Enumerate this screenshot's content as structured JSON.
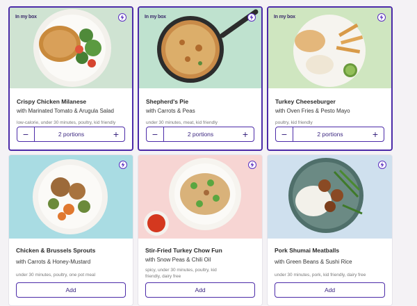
{
  "badge_text": "In my box",
  "stepper_minus": "−",
  "stepper_plus": "+",
  "add_label": "Add",
  "accent_color": "#4b2aa8",
  "meals": [
    {
      "title": "Crispy Chicken Milanese",
      "subtitle": "with Marinated Tomato & Arugula Salad",
      "tags": "low-calorie, under 30 minutes, poultry, kid friendly",
      "in_box": true,
      "portions": "2 portions",
      "photo_bg": "#cfe3d2"
    },
    {
      "title": "Shepherd's Pie",
      "subtitle": "with Carrots & Peas",
      "tags": "under 30 minutes, meat, kid friendly",
      "in_box": true,
      "portions": "2 portions",
      "photo_bg": "#bfe2cf"
    },
    {
      "title": "Turkey Cheeseburger",
      "subtitle": "with Oven Fries & Pesto Mayo",
      "tags": "poultry, kid friendly",
      "in_box": true,
      "portions": "2 portions",
      "photo_bg": "#cfe6c0"
    },
    {
      "title": "Chicken & Brussels Sprouts",
      "subtitle": "with Carrots & Honey-Mustard",
      "tags": "under 30 minutes, poultry, one pot meal",
      "in_box": false,
      "photo_bg": "#a9dce3"
    },
    {
      "title": "Stir-Fried Turkey Chow Fun",
      "subtitle": "with Snow Peas & Chili Oil",
      "tags": "spicy, under 30 minutes, poultry, kid friendly, dairy free",
      "in_box": false,
      "photo_bg": "#f7d5d3"
    },
    {
      "title": "Pork Shumai Meatballs",
      "subtitle": "with Green Beans & Sushi Rice",
      "tags": "under 30 minutes, pork, kid friendly, dairy free",
      "in_box": false,
      "photo_bg": "#cfe0ee"
    }
  ]
}
